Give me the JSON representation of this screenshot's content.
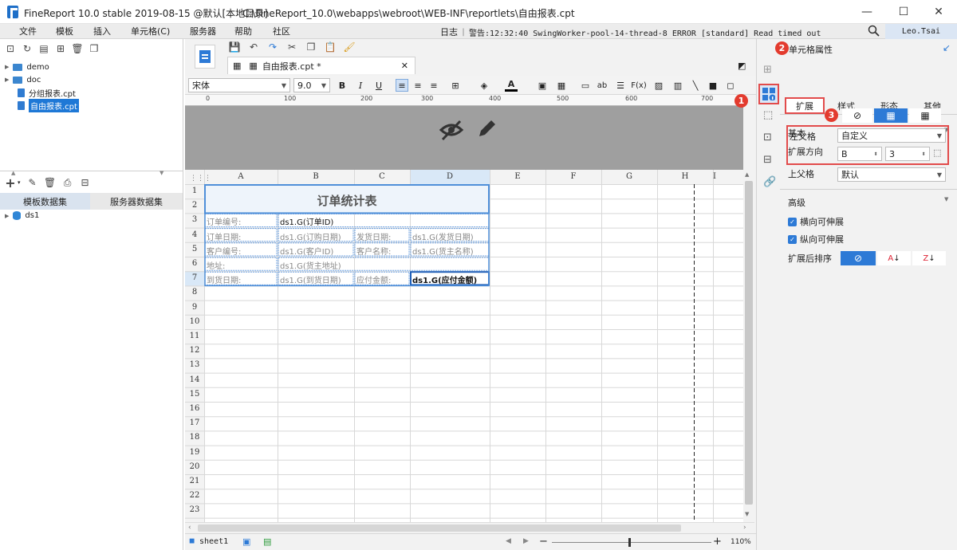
{
  "window": {
    "app_title": "FineReport 10.0 stable 2019-08-15 @默认[本地目录]",
    "file_path": "C:\\FineReport_10.0\\webapps\\webroot\\WEB-INF\\reportlets\\自由报表.cpt",
    "minimize": "—",
    "maximize": "☐",
    "close": "✕"
  },
  "menu": [
    "文件",
    "模板",
    "插入",
    "单元格(C)",
    "服务器",
    "帮助",
    "社区"
  ],
  "log": {
    "label": "日志",
    "alert": "警告:12:32:40 SwingWorker-pool-14-thread-8 ERROR [standard] Read timed out"
  },
  "user": "Leo.Tsai",
  "tree": {
    "items": [
      {
        "label": "demo",
        "type": "folder"
      },
      {
        "label": "doc",
        "type": "folder"
      },
      {
        "label": "分组报表.cpt",
        "type": "file"
      },
      {
        "label": "自由报表.cpt",
        "type": "file",
        "selected": true
      }
    ]
  },
  "dataset": {
    "tab_template": "模板数据集",
    "tab_server": "服务器数据集",
    "items": [
      "ds1"
    ]
  },
  "doc_tab": "自由报表.cpt *",
  "format": {
    "font": "宋体",
    "size": "9.0",
    "bold": "B",
    "italic": "I",
    "underline": "U"
  },
  "ruler": [
    "0",
    "100",
    "200",
    "300",
    "400",
    "500",
    "600",
    "700"
  ],
  "columns": [
    "A",
    "B",
    "C",
    "D",
    "E",
    "F",
    "G",
    "H",
    "I"
  ],
  "rows": [
    "1",
    "2",
    "3",
    "4",
    "5",
    "6",
    "7",
    "8",
    "9",
    "10",
    "11",
    "12",
    "13",
    "14",
    "15",
    "16",
    "17",
    "18",
    "19",
    "20",
    "21",
    "22",
    "23"
  ],
  "cells": {
    "title": "订单统计表",
    "r3_a": "订单编号:",
    "r3_b": "ds1.G(订单ID)",
    "r4_a": "订单日期:",
    "r4_b": "ds1.G(订购日期)",
    "r4_c": "发货日期:",
    "r4_d": "ds1.G(发货日期)",
    "r5_a": "客户编号:",
    "r5_b": "ds1.G(客户ID)",
    "r5_c": "客户名称:",
    "r5_d": "ds1.G(货主名称)",
    "r6_a": "地址:",
    "r6_b": "ds1.G(货主地址)",
    "r7_a": "到货日期:",
    "r7_b": "ds1.G(到货日期)",
    "r7_c": "应付金额:",
    "r7_d": "ds1.G(应付金额)"
  },
  "status": {
    "sheet": "sheet1",
    "zoom": "110%",
    "zoom_level": 0.48
  },
  "right": {
    "title": "单元格属性",
    "tabs": [
      "扩展",
      "样式",
      "形态",
      "其他"
    ],
    "basic": "基本",
    "expand_dir": "扩展方向",
    "left_parent": "左父格",
    "left_parent_value": "自定义",
    "left_col": "B",
    "left_row": "3",
    "up_parent": "上父格",
    "up_parent_value": "默认",
    "advanced": "高级",
    "h_expand": "横向可伸展",
    "v_expand": "纵向可伸展",
    "sort": "扩展后排序"
  },
  "badges": [
    "1",
    "2",
    "3"
  ],
  "colors": {
    "accent": "#2d7ad6",
    "badge": "#e33b2e",
    "highlight": "#e24b4b"
  }
}
